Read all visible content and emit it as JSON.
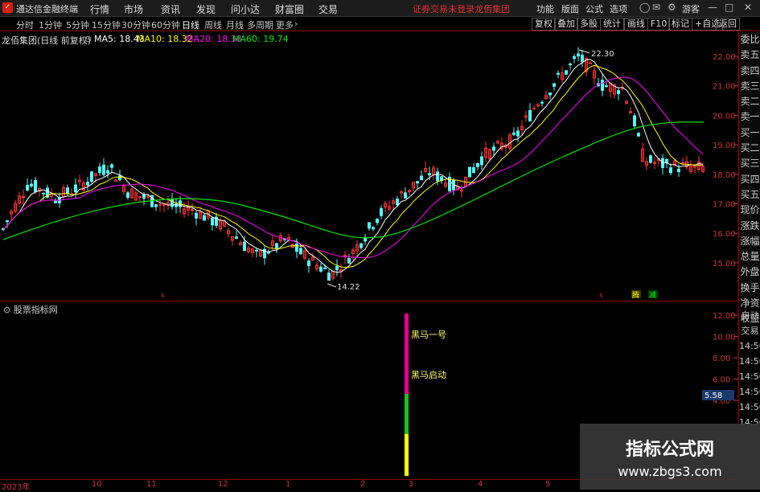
{
  "app": {
    "name": "通达信金融终端",
    "notice": "证券交易未登录",
    "stock_title": "龙佰集团"
  },
  "menu": [
    "行情",
    "市场",
    "资讯",
    "发现",
    "问小达",
    "财富圈",
    "交易"
  ],
  "topright": [
    "功能",
    "版面",
    "公式",
    "选项",
    "游客"
  ],
  "periods": [
    {
      "label": "分时",
      "active": false
    },
    {
      "label": "1分钟",
      "active": false
    },
    {
      "label": "5分钟",
      "active": false
    },
    {
      "label": "15分钟",
      "active": false
    },
    {
      "label": "30分钟",
      "active": false
    },
    {
      "label": "60分钟",
      "active": false
    },
    {
      "label": "日线",
      "active": true
    },
    {
      "label": "周线",
      "active": false
    },
    {
      "label": "月线",
      "active": false
    },
    {
      "label": "多周期",
      "active": false
    },
    {
      "label": "更多",
      "active": false
    }
  ],
  "toolbar_right": [
    "复权",
    "叠加",
    "多股",
    "统计",
    "画线",
    "F10",
    "标记",
    "+自选",
    "返回"
  ],
  "info": {
    "name": "龙佰集团(日线 前复权)",
    "ma5": "MA5: 18.43",
    "ma10": "MA10: 18.32",
    "ma20": "MA20: 18.38",
    "ma60": "MA60: 19.74"
  },
  "sidebar_top": [
    "委比",
    "卖五",
    "卖四",
    "卖三",
    "卖二",
    "卖一",
    "买一",
    "买二",
    "买三",
    "买四",
    "买五",
    "现价",
    "涨跌",
    "涨幅",
    "总量",
    "外盘",
    "换手",
    "净资",
    "收益"
  ],
  "sidebar_bottom": [
    "自动",
    "交易",
    "14:50",
    "14:50",
    "14:50",
    "14:50",
    "14:50",
    "14:50",
    "14:50"
  ],
  "indicator": {
    "title": "股票指标网",
    "label1": "黑马一号",
    "label2": "黑马启动",
    "badge": "5.58"
  },
  "price_axis": [
    "22.00",
    "21.00",
    "20.00",
    "19.00",
    "18.00",
    "17.00",
    "16.00",
    "15.00"
  ],
  "ind_axis": [
    "12.00",
    "10.00",
    "8.00",
    "6.00",
    "4.00"
  ],
  "annotations": {
    "high": "22.30",
    "low": "14.22",
    "tag1": "腾",
    "tag2": "减"
  },
  "xaxis": [
    "2023年",
    "10",
    "11",
    "12",
    "1",
    "2",
    "3",
    "4",
    "5"
  ],
  "watermark": {
    "line1": "指标公式网",
    "line2": "www.zbgs3.com"
  },
  "colors": {
    "up": "#ff3232",
    "down": "#54fcfc",
    "ma5": "#ffffff",
    "ma10": "#ffff00",
    "ma20": "#ff00ff",
    "ma60": "#00e600"
  }
}
